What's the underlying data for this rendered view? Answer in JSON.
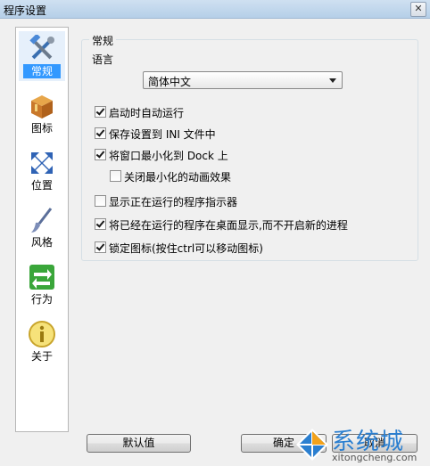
{
  "window": {
    "title": "程序设置",
    "close_glyph": "✕"
  },
  "sidebar": {
    "items": [
      {
        "label": "常规",
        "icon": "tools-icon",
        "active": true
      },
      {
        "label": "图标",
        "icon": "box-icon"
      },
      {
        "label": "位置",
        "icon": "arrows-icon"
      },
      {
        "label": "风格",
        "icon": "brush-icon"
      },
      {
        "label": "行为",
        "icon": "swap-icon"
      },
      {
        "label": "关于",
        "icon": "info-icon"
      }
    ]
  },
  "general": {
    "group_title": "常规",
    "language_label": "语言",
    "language_value": "简体中文",
    "options": [
      {
        "label": "启动时自动运行",
        "checked": true
      },
      {
        "label": "保存设置到 INI 文件中",
        "checked": true
      },
      {
        "label": "将窗口最小化到 Dock 上",
        "checked": true
      },
      {
        "label": "关闭最小化的动画效果",
        "checked": false
      },
      {
        "label": "显示正在运行的程序指示器",
        "checked": false
      },
      {
        "label": "将已经在运行的程序在桌面显示,而不开启新的进程",
        "checked": true
      },
      {
        "label": "锁定图标(按住ctrl可以移动图标)",
        "checked": true
      }
    ]
  },
  "buttons": {
    "default": "默认值",
    "ok": "确定",
    "cancel": "取消"
  },
  "watermark": {
    "text": "系统城",
    "domain": "xitongcheng.com"
  },
  "colors": {
    "accent": "#3399ff",
    "watermark": "#2b7fd0"
  }
}
